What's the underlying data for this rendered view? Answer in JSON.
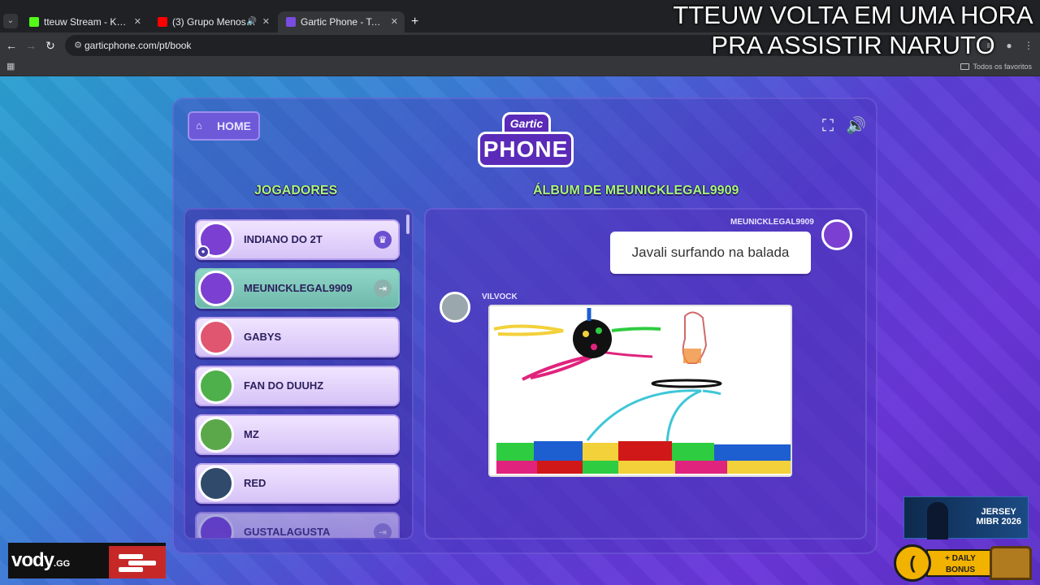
{
  "browser": {
    "tabs": [
      {
        "title": "tteuw Stream - Kick Dashboard",
        "favicon_color": "#53fc18",
        "active": false
      },
      {
        "title": "(3) Grupo Menos é Mais - O",
        "favicon_color": "#ff0000",
        "active": false,
        "audio": true
      },
      {
        "title": "Gartic Phone - Telefone sem fio",
        "favicon_color": "#7a4ce0",
        "active": true
      }
    ],
    "url": "garticphone.com/pt/book",
    "bookmarks_folder": "Todos os favoritos"
  },
  "overlay": {
    "line1": "TTEUW VOLTA EM UMA HORA",
    "line2": "PRA ASSISTIR NARUTO"
  },
  "game": {
    "home_label": "HOME",
    "logo_top": "Gartic",
    "logo_bottom": "PHONE",
    "players_title": "JOGADORES",
    "album_title": "ÁLBUM DE MEUNICKLEGAL9909",
    "players": [
      {
        "name": "INDIANO DO 2T",
        "color": "#7b3fd1",
        "state": "owner"
      },
      {
        "name": "MEUNICKLEGAL9909",
        "color": "#7b3fd1",
        "state": "me"
      },
      {
        "name": "GABYS",
        "color": "#e0556f",
        "state": "normal"
      },
      {
        "name": "FAN DO DUUHZ",
        "color": "#4db04a",
        "state": "normal"
      },
      {
        "name": "MZ",
        "color": "#5aa84a",
        "state": "normal"
      },
      {
        "name": "RED",
        "color": "#2f4a6a",
        "state": "normal"
      },
      {
        "name": "GUSTALAGUSTA",
        "color": "#7b3fd1",
        "state": "faded"
      }
    ],
    "album": {
      "prompt_author": "MEUNICKLEGAL9909",
      "prompt_text": "Javali surfando na balada",
      "drawing_author": "VILVOCK"
    }
  },
  "widgets": {
    "vody_brand": "vody",
    "vody_suffix": ".GG",
    "jersey_line1": "JERSEY",
    "jersey_line2": "MIBR 2026",
    "bonus_line1": "+ DAILY",
    "bonus_line2": "BONUS"
  }
}
